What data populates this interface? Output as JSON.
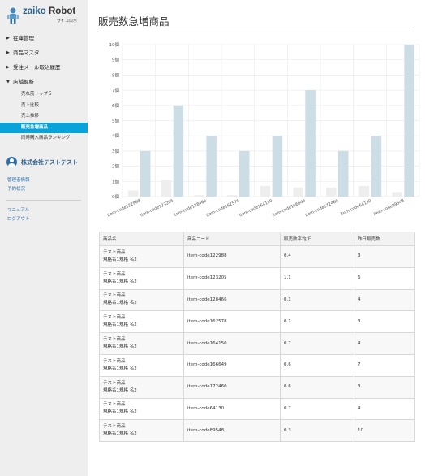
{
  "logo": {
    "title_zaiko": "zaiko",
    "title_robot": "Robot",
    "subtitle": "ザイコロボ"
  },
  "nav": {
    "items": [
      {
        "label": "在庫管理"
      },
      {
        "label": "商品マスタ"
      },
      {
        "label": "受注メール取込履歴"
      },
      {
        "label": "店舗解析"
      }
    ],
    "sub_items": [
      {
        "label": "売れ筋トップ５"
      },
      {
        "label": "売上比較"
      },
      {
        "label": "売上推移"
      },
      {
        "label": "販売急増商品",
        "active": true
      },
      {
        "label": "同時購入商品ランキング"
      }
    ]
  },
  "company": {
    "name": "株式会社テストテスト",
    "icon": "user-avatar-icon"
  },
  "account_links": [
    {
      "label": "管理者情報"
    },
    {
      "label": "予約状況"
    }
  ],
  "help_links": [
    {
      "label": "マニュアル"
    },
    {
      "label": "ログアウト"
    }
  ],
  "page": {
    "title": "販売数急増商品"
  },
  "chart_data": {
    "type": "bar",
    "categories": [
      "item-code122988",
      "item-code123205",
      "item-code128466",
      "item-code162578",
      "item-code164150",
      "item-code166649",
      "item-code172460",
      "item-code64130",
      "item-code89548"
    ],
    "series": [
      {
        "values": [
          0.4,
          1.1,
          0.1,
          0.1,
          0.7,
          0.6,
          0.6,
          0.7,
          0.3
        ],
        "color": "#eeeeee"
      },
      {
        "values": [
          3,
          6,
          4,
          3,
          4,
          7,
          3,
          4,
          10
        ],
        "color": "#cddde6"
      }
    ],
    "ylim": [
      0,
      10
    ],
    "yticks": [
      "0個",
      "1個",
      "2個",
      "3個",
      "4個",
      "5個",
      "6個",
      "7個",
      "8個",
      "9個",
      "10個"
    ],
    "grid": true
  },
  "table": {
    "headers": [
      "商品名",
      "商品コード",
      "販売数平均/日",
      "昨日販売数"
    ],
    "rows": [
      {
        "name": "テスト商品",
        "spec": "規格名1規格 名2",
        "code": "item-code122988",
        "avg": "0.4",
        "yesterday": "3"
      },
      {
        "name": "テスト商品",
        "spec": "規格名1規格 名2",
        "code": "item-code123205",
        "avg": "1.1",
        "yesterday": "6"
      },
      {
        "name": "テスト商品",
        "spec": "規格名1規格 名2",
        "code": "item-code128466",
        "avg": "0.1",
        "yesterday": "4"
      },
      {
        "name": "テスト商品",
        "spec": "規格名1規格 名2",
        "code": "item-code162578",
        "avg": "0.1",
        "yesterday": "3"
      },
      {
        "name": "テスト商品",
        "spec": "規格名1規格 名2",
        "code": "item-code164150",
        "avg": "0.7",
        "yesterday": "4"
      },
      {
        "name": "テスト商品",
        "spec": "規格名1規格 名2",
        "code": "item-code166649",
        "avg": "0.6",
        "yesterday": "7"
      },
      {
        "name": "テスト商品",
        "spec": "規格名1規格 名2",
        "code": "item-code172460",
        "avg": "0.6",
        "yesterday": "3"
      },
      {
        "name": "テスト商品",
        "spec": "規格名1規格 名2",
        "code": "item-code64130",
        "avg": "0.7",
        "yesterday": "4"
      },
      {
        "name": "テスト商品",
        "spec": "規格名1規格 名2",
        "code": "item-code89548",
        "avg": "0.3",
        "yesterday": "10"
      }
    ]
  }
}
